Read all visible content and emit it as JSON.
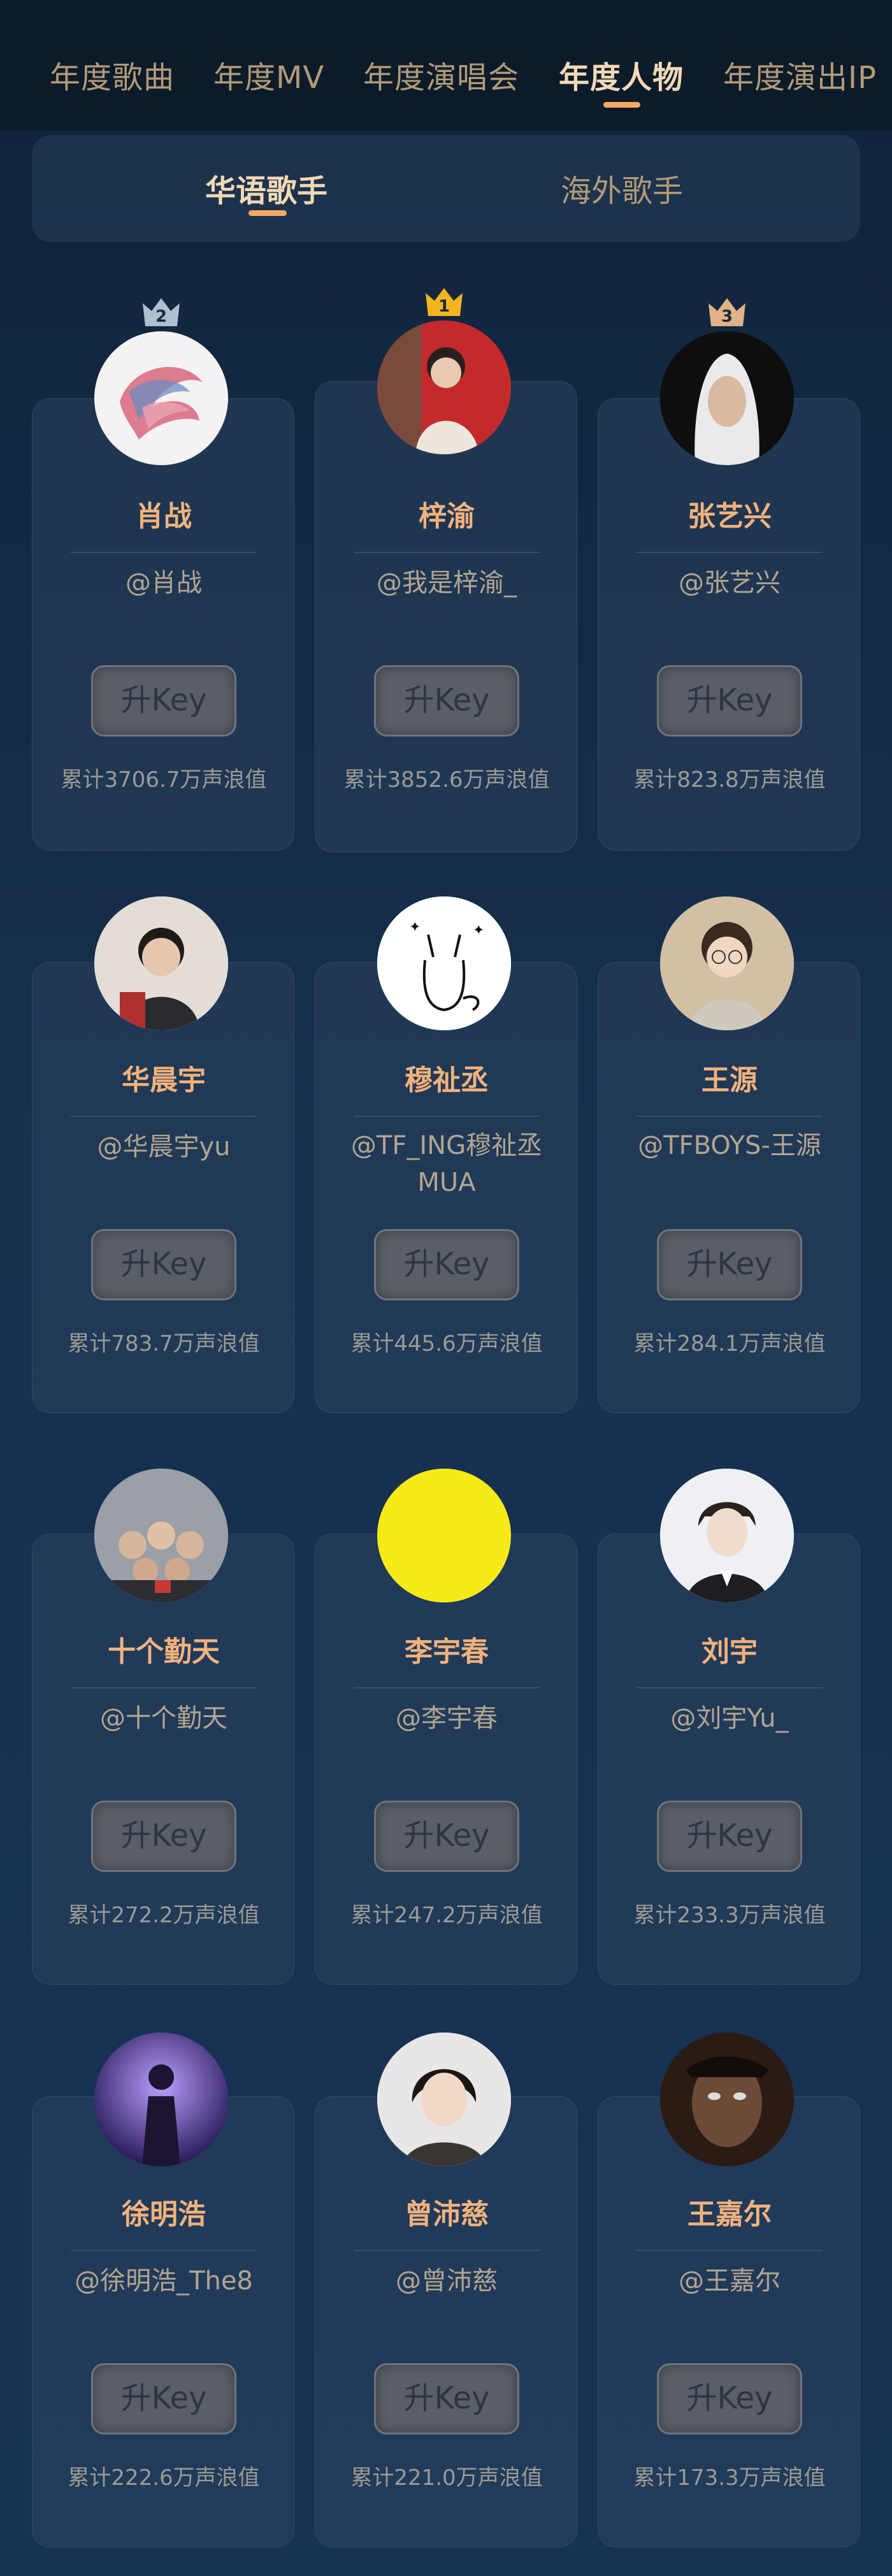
{
  "top_tabs": [
    {
      "label": "年度歌曲",
      "active": false
    },
    {
      "label": "年度MV",
      "active": false
    },
    {
      "label": "年度演唱会",
      "active": false
    },
    {
      "label": "年度人物",
      "active": true
    },
    {
      "label": "年度演出IP",
      "active": false
    }
  ],
  "sub_tabs": [
    {
      "label": "华语歌手",
      "active": true
    },
    {
      "label": "海外歌手",
      "active": false
    }
  ],
  "button_label": "升Key",
  "colors": {
    "accent": "#f4a863",
    "name": "#f3b27c",
    "gold_crown": "#f2b51d",
    "silver_crown": "#aebfd2",
    "bronze_crown": "#e2b287"
  },
  "artists": [
    {
      "rank": "2",
      "name": "肖战",
      "handle": "@肖战",
      "total": "累计3706.7万声浪值",
      "avatar": "abstract-brush-avatar"
    },
    {
      "rank": "1",
      "name": "梓渝",
      "handle": "@我是梓渝_",
      "total": "累计3852.6万声浪值",
      "avatar": "photo-avatar"
    },
    {
      "rank": "3",
      "name": "张艺兴",
      "handle": "@张艺兴",
      "total": "累计823.8万声浪值",
      "avatar": "photo-avatar"
    },
    {
      "rank": "",
      "name": "华晨宇",
      "handle": "@华晨宇yu",
      "total": "累计783.7万声浪值",
      "avatar": "photo-avatar"
    },
    {
      "rank": "",
      "name": "穆祉丞",
      "handle": "@TF_ING穆祉丞MUA",
      "total": "累计445.6万声浪值",
      "avatar": "cat-sketch-avatar"
    },
    {
      "rank": "",
      "name": "王源",
      "handle": "@TFBOYS-王源",
      "total": "累计284.1万声浪值",
      "avatar": "photo-avatar"
    },
    {
      "rank": "",
      "name": "十个勤天",
      "handle": "@十个勤天",
      "total": "累计272.2万声浪值",
      "avatar": "group-photo-avatar"
    },
    {
      "rank": "",
      "name": "李宇春",
      "handle": "@李宇春",
      "total": "累计247.2万声浪值",
      "avatar": "yellow-circle-avatar"
    },
    {
      "rank": "",
      "name": "刘宇",
      "handle": "@刘宇Yu_",
      "total": "累计233.3万声浪值",
      "avatar": "photo-avatar"
    },
    {
      "rank": "",
      "name": "徐明浩",
      "handle": "@徐明浩_The8",
      "total": "累计222.6万声浪值",
      "avatar": "stage-photo-avatar"
    },
    {
      "rank": "",
      "name": "曾沛慈",
      "handle": "@曾沛慈",
      "total": "累计221.0万声浪值",
      "avatar": "photo-avatar"
    },
    {
      "rank": "",
      "name": "王嘉尔",
      "handle": "@王嘉尔",
      "total": "累计173.3万声浪值",
      "avatar": "dark-photo-avatar"
    }
  ]
}
